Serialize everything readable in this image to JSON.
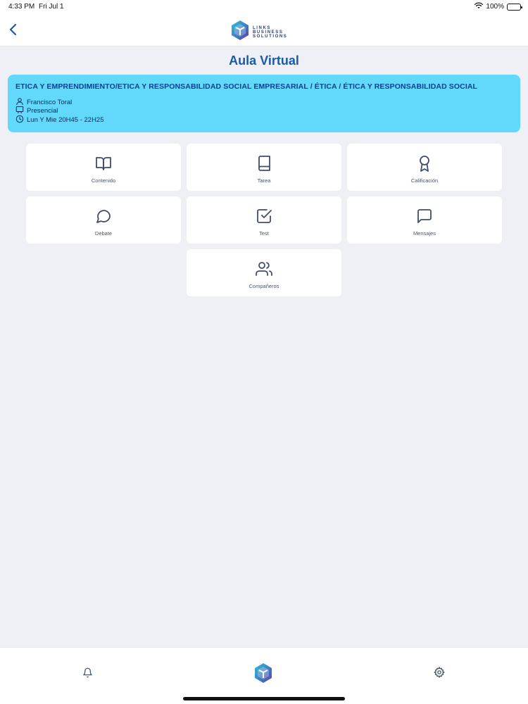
{
  "status_bar": {
    "time": "4:33 PM",
    "date": "Fri Jul 1",
    "battery": "100%"
  },
  "brand": {
    "line1": "LINKS",
    "line2": "BUSINESS",
    "line3": "SOLUTIONS"
  },
  "page": {
    "title": "Aula Virtual"
  },
  "course": {
    "title": "ETICA Y EMPRENDIMIENTO/ETICA Y RESPONSABILIDAD SOCIAL EMPRESARIAL / ÉTICA / ÉTICA Y RESPONSABILIDAD SOCIAL",
    "teacher": "Francisco Toral",
    "modality": "Presencial",
    "schedule": "Lun Y Mie 20H45 - 22H25"
  },
  "tiles": [
    {
      "label": "Contenido",
      "icon": "book-open-icon"
    },
    {
      "label": "Tarea",
      "icon": "book-icon"
    },
    {
      "label": "Calificación",
      "icon": "award-icon"
    },
    {
      "label": "Debate",
      "icon": "chat-bubble-icon"
    },
    {
      "label": "Test",
      "icon": "checkbox-icon"
    },
    {
      "label": "Mensajes",
      "icon": "message-square-icon"
    },
    {
      "label": "Compañeros",
      "icon": "users-icon"
    }
  ],
  "tab_bar": {
    "left": "bell-icon",
    "center": "logo-icon",
    "right": "gear-icon"
  },
  "colors": {
    "accent": "#1a5aa8",
    "card": "#62d8fb",
    "background": "#eef0f5",
    "icon": "#3f4d6b"
  }
}
